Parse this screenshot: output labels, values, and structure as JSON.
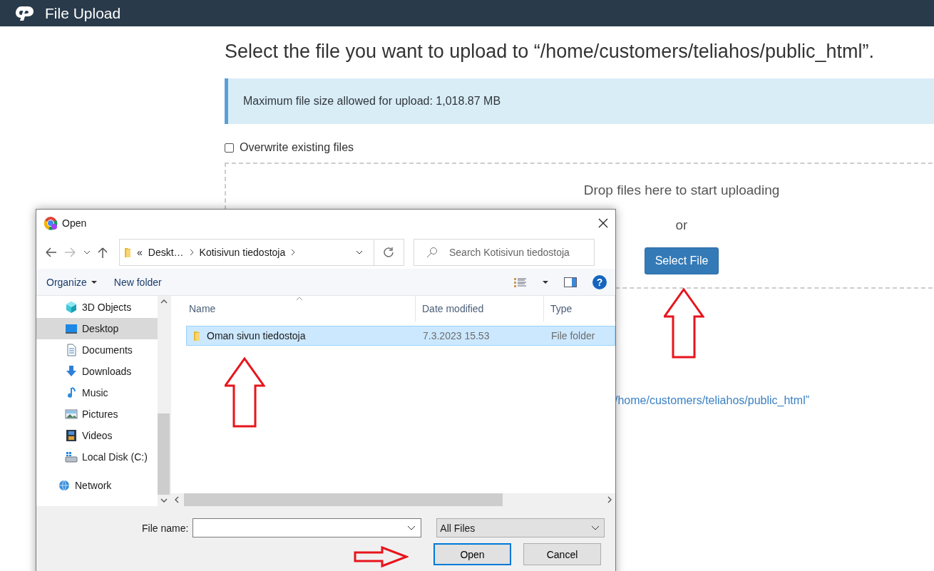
{
  "header": {
    "title": "File Upload"
  },
  "page": {
    "heading": "Select the file you want to upload to “/home/customers/teliahos/public_html”.",
    "info": "Maximum file size allowed for upload: 1,018.87 MB",
    "overwrite": {
      "label": "Overwrite existing files",
      "checked": false
    },
    "dropzone": {
      "text": "Drop files here to start uploading",
      "or": "or",
      "button": "Select File"
    },
    "link": "/home/customers/teliahos/public_html”"
  },
  "dialog": {
    "title": "Open",
    "path": {
      "prefix": "«",
      "crumbs": [
        "Deskt…",
        "Kotisivun tiedostoja"
      ]
    },
    "search": {
      "placeholder": "Search Kotisivun tiedostoja"
    },
    "toolbar": {
      "organize": "Organize",
      "new_folder": "New folder",
      "help": "?"
    },
    "nav": [
      {
        "label": "3D Objects",
        "kind": "objects",
        "selected": false
      },
      {
        "label": "Desktop",
        "kind": "desktop",
        "selected": true
      },
      {
        "label": "Documents",
        "kind": "documents",
        "selected": false
      },
      {
        "label": "Downloads",
        "kind": "downloads",
        "selected": false
      },
      {
        "label": "Music",
        "kind": "music",
        "selected": false
      },
      {
        "label": "Pictures",
        "kind": "pictures",
        "selected": false
      },
      {
        "label": "Videos",
        "kind": "videos",
        "selected": false
      },
      {
        "label": "Local Disk (C:)",
        "kind": "disk",
        "selected": false
      },
      {
        "label": "Network",
        "kind": "network",
        "selected": false
      }
    ],
    "columns": [
      "Name",
      "Date modified",
      "Type"
    ],
    "rows": [
      {
        "name": "Oman sivun tiedostoja",
        "date": "7.3.2023 15.53",
        "type": "File folder",
        "selected": true
      }
    ],
    "file_name": {
      "label": "File name:"
    },
    "filter": "All Files",
    "buttons": [
      "Open",
      "Cancel"
    ]
  }
}
